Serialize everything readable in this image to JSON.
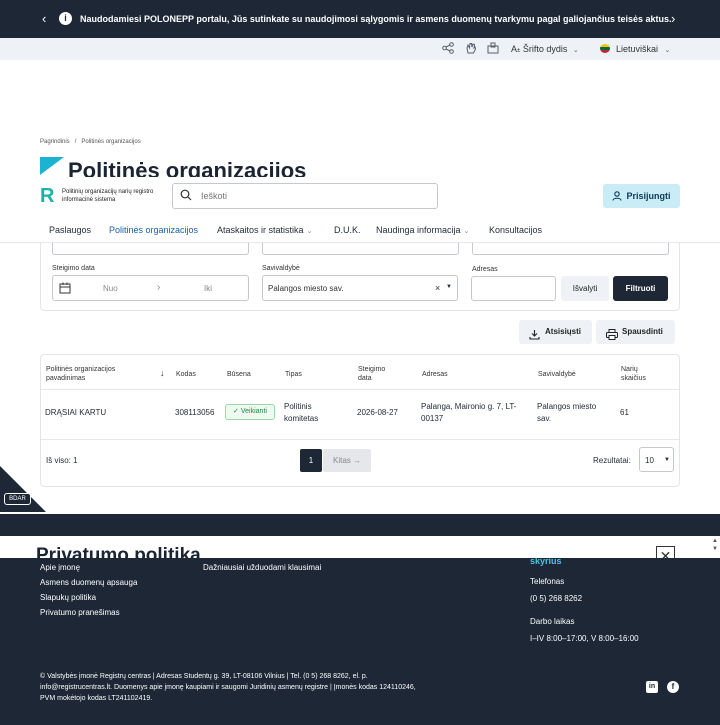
{
  "notice": {
    "text": "Naudodamiesi POLONEPP portalu, Jūs sutinkate su naudojimosi sąlygomis ir asmens duomenų tvarkymu pagal galiojančius teisės aktus.",
    "prev": "‹",
    "next": "›",
    "info": "i"
  },
  "utility": {
    "font_size_label": "Šrifto dydis",
    "font_size_prefix": "A",
    "language_label": "Lietuviškai"
  },
  "breadcrumb": {
    "home": "Pagrindinis",
    "separator": "/",
    "current": "Politinės organizacijos"
  },
  "page_title": "Politinės organizacijos",
  "logo": {
    "mark": "R",
    "name": "Politinių organizacijų narių registro informacinė sistema"
  },
  "search": {
    "placeholder": "Ieškoti"
  },
  "login_label": "Prisijungti",
  "nav": [
    {
      "label": "Paslaugos"
    },
    {
      "label": "Politinės organizacijos"
    },
    {
      "label": "Ataskaitos ir statistika"
    },
    {
      "label": "D.U.K."
    },
    {
      "label": "Naudinga informacija"
    },
    {
      "label": "Konsultacijos"
    }
  ],
  "filters": {
    "date_label": "Steigimo data",
    "date_from": "Nuo",
    "date_arrow": "›",
    "date_to": "Iki",
    "municipality_label": "Savivaldybė",
    "municipality_value": "Palangos miesto sav.",
    "address_label": "Adresas",
    "address_value": "",
    "clear_label": "Išvalyti",
    "filter_label": "Filtruoti"
  },
  "toolbar": {
    "download_label": "Atsisiųsti",
    "print_label": "Spausdinti"
  },
  "table": {
    "headers": {
      "name": "Politinės organizacijos pavadinimas",
      "code": "Kodas",
      "status": "Būsena",
      "type": "Tipas",
      "date": "Steigimo data",
      "address": "Adresas",
      "municipality": "Savivaldybė",
      "members": "Narių skaičius"
    },
    "rows": [
      {
        "name": "DRĄSIAI KARTU",
        "code": "308113056",
        "status": "Veikianti",
        "type": "Politinis komitetas",
        "date": "2026-08-27",
        "address": "Palanga, Maironio g. 7, LT-00137",
        "municipality": "Palangos miesto sav.",
        "members": "61"
      }
    ],
    "total_label": "Iš viso: 1",
    "page": "1",
    "next_label": "Kitas →",
    "per_page_label": "Rezultatai:",
    "per_page_value": "10"
  },
  "bdar_label": "BDAR",
  "privacy_title": "Privatumo politika",
  "modal_close": "✕",
  "footer": {
    "links_col1": [
      "Apie įmonę",
      "Asmens duomenų apsauga",
      "Slapukų politika",
      "Privatumo pranešimas"
    ],
    "links_col2": [
      "Dažniausiai užduodami klausimai"
    ],
    "dept_label": "skyrius",
    "phone_label": "Telefonas",
    "phone_value": "(0 5) 268 8262",
    "hours_label": "Darbo laikas",
    "hours_value": "I–IV 8:00–17:00, V 8:00–16:00",
    "legal_line1": "© Valstybės įmonė Registrų centras | Adresas Studentų g. 39, LT-08106 Vilnius | Tel. (0 5) 268 8262, el. p.",
    "legal_line2": "info@registrucentras.lt. Duomenys apie įmonę kaupiami ir saugomi Juridinių asmenų registre | Įmonės kodas 124110246,",
    "legal_line3": "PVM mokėtojo kodas LT241102419.",
    "linkedin": "in",
    "facebook": "f"
  },
  "colors": {
    "dark": "#1d2736",
    "accent": "#1bb3d1",
    "login_bg": "#c9ecf7",
    "nav_active": "#1a5fa3",
    "status_green": "#1e8a3a"
  },
  "icons": [
    "info-icon",
    "share-icon",
    "hand-icon",
    "sign-language-icon",
    "font-size-icon",
    "lithuania-flag-icon",
    "search-icon",
    "user-icon",
    "calendar-icon",
    "download-icon",
    "print-icon",
    "sort-arrow-icon",
    "check-icon",
    "close-icon",
    "linkedin-icon",
    "facebook-icon"
  ]
}
